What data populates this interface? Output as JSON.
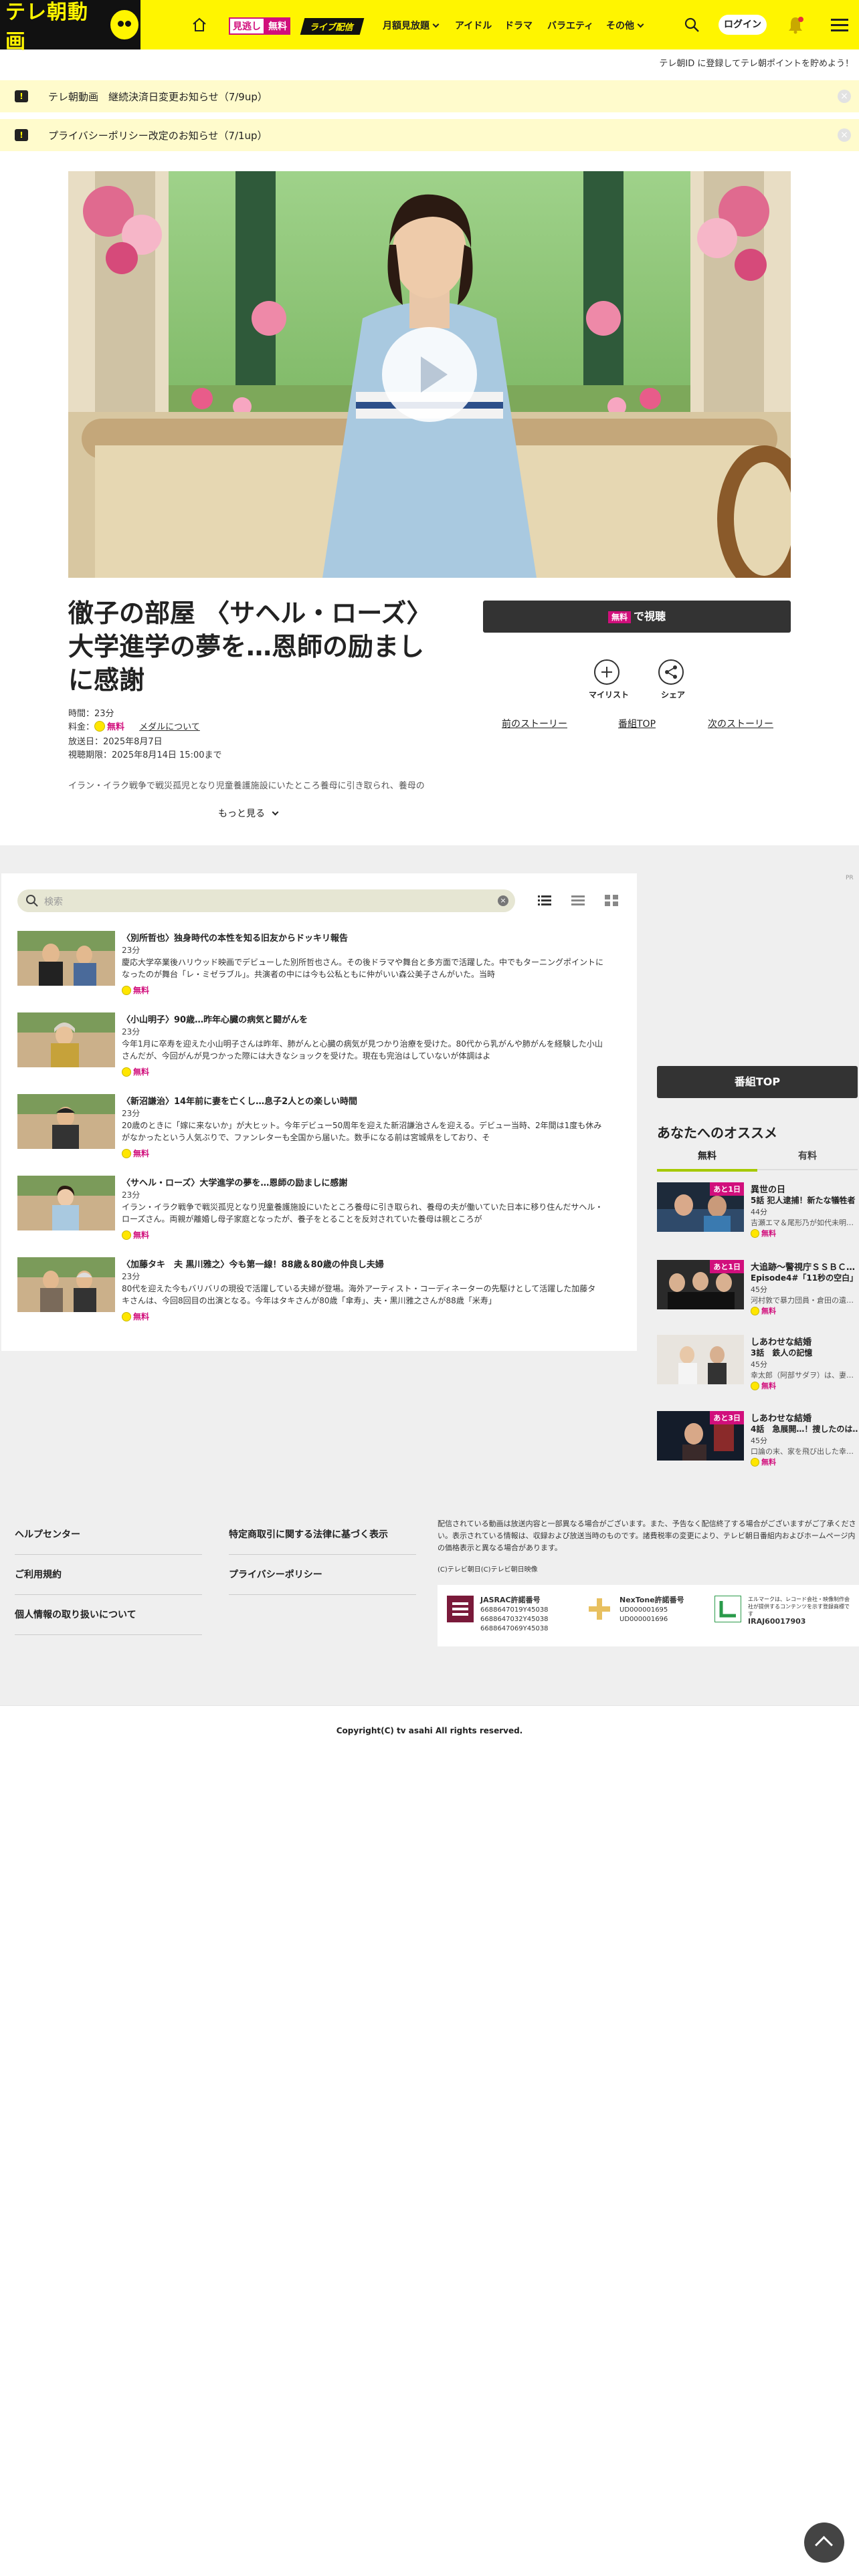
{
  "header": {
    "logo_text": "テレ朝動画",
    "badge_mitai": "見逃し",
    "badge_free": "無料",
    "badge_live": "ライブ配信",
    "nav": [
      "月額見放題",
      "アイドル",
      "ドラマ",
      "バラエティ",
      "その他"
    ],
    "login_label": "ログイン",
    "promo_text": "テレ朝ID に登録してテレ朝ポイントを貯めよう！"
  },
  "notices": [
    {
      "text": "テレ朝動画　継続決済日変更お知らせ（7/9up）"
    },
    {
      "text": "プライバシーポリシー改定のお知らせ（7/1up）"
    }
  ],
  "program": {
    "title": "徹子の部屋 〈サヘル・ローズ〉大学進学の夢を…恩師の励ましに感謝",
    "duration": "時間：23分",
    "price_label": "料金：",
    "price_free": "無料",
    "price_link": "メダルについて",
    "air_date": "放送日：2025年8月7日",
    "deadline": "視聴期限：2025年8月14日 15:00まで",
    "description": "イラン・イラク戦争で戦災孤児となり児童養護施設にいたところ養母に引き取られ、養母の",
    "more_label": "もっと見る",
    "watch_tag": "無料",
    "watch_label": "で視聴",
    "mylist_label": "マイリスト",
    "share_label": "シェア",
    "prev_label": "前のストーリー",
    "top_label": "番組TOP",
    "next_label": "次のストーリー"
  },
  "list": {
    "search_placeholder": "検索",
    "pr_label": "PR",
    "free_label": "無料",
    "episodes": [
      {
        "title": "〈別所哲也〉独身時代の本性を知る旧友からドッキリ報告",
        "duration": "23分",
        "desc": "慶応大学卒業後ハリウッド映画でデビューした別所哲也さん。その後ドラマや舞台と多方面で活躍した。中でもターニングポイントになったのが舞台「レ・ミゼラブル」。共演者の中には今も公私ともに仲がいい森公美子さんがいた。当時"
      },
      {
        "title": "〈小山明子〉90歳…昨年心臓の病気と闘がんを",
        "duration": "23分",
        "desc": "今年1月に卒寿を迎えた小山明子さんは昨年、肺がんと心臓の病気が見つかり治療を受けた。80代から乳がんや肺がんを経験した小山さんだが、今回がんが見つかった際には大きなショックを受けた。現在も完治はしていないが体調はよ"
      },
      {
        "title": "〈新沼謙治〉14年前に妻を亡くし…息子2人との楽しい時間",
        "duration": "23分",
        "desc": "20歳のときに「嫁に来ないか」が大ヒット。今年デビュー50周年を迎えた新沼謙治さんを迎える。デビュー当時、2年間は1度も休みがなかったという人気ぶりで、ファンレターも全国から届いた。数手になる前は宮城県をしており、そ"
      },
      {
        "title": "〈サヘル・ローズ〉大学進学の夢を…恩師の励ましに感謝",
        "duration": "23分",
        "desc": "イラン・イラク戦争で戦災孤児となり児童養護施設にいたところ養母に引き取られ、養母の夫が働いていた日本に移り住んだサヘル・ローズさん。両親が離婚し母子家庭となったが、養子をとることを反対されていた養母は親ところが"
      },
      {
        "title": "〈加藤タキ　夫 黒川雅之〉今も第一線！88歳＆80歳の仲良し夫婦",
        "duration": "23分",
        "desc": "80代を迎えた今もバリバリの現役で活躍している夫婦が登場。海外アーティスト・コーディネーターの先駆けとして活躍した加藤タキさんは、今回8回目の出演となる。今年はタキさんが80歳「傘寿」、夫・黒川雅之さんが88歳「米寿」"
      }
    ]
  },
  "sidebar": {
    "top_button": "番組TOP",
    "heading": "あなたへのオススメ",
    "tabs": [
      "無料",
      "有料"
    ],
    "items": [
      {
        "badge": "あと1日",
        "title": "異世の日",
        "subtitle": "5話 犯人逮捕！新たな犠牲者",
        "duration": "44分",
        "desc": "吉瀬エマ＆尾形乃が如代未明…"
      },
      {
        "badge": "あと1日",
        "title": "大追跡〜警視庁ＳＳＢＣ…",
        "subtitle": "Episode4#「11秒の空白」",
        "duration": "45分",
        "desc": "河村敦で暴力団員・倉田の遺…"
      },
      {
        "badge": "",
        "title": "しあわせな結婚",
        "subtitle": "3話　鉄人の記憶",
        "duration": "45分",
        "desc": "幸太郎（阿部サダヲ）は、妻…"
      },
      {
        "badge": "あと3日",
        "title": "しあわせな結婚",
        "subtitle": "4話　急展開…！捜したのは…",
        "duration": "45分",
        "desc": "口論の末、家を飛び出した幸…"
      }
    ]
  },
  "footer": {
    "links_left": [
      "ヘルプセンター",
      "ご利用規約",
      "個人情報の取り扱いについて"
    ],
    "links_mid": [
      "特定商取引に関する法律に基づく表示",
      "プライバシーポリシー"
    ],
    "note": "配信されている動画は放送内容と一部異なる場合がございます。また、予告なく配信終了する場合がございますがご了承ください。表示されている情報は、収録および放送当時のものです。諸費税率の変更により、テレビ朝日番組内およびホームページ内の価格表示と異なる場合があります。",
    "copyright_small": "(C)テレビ朝日(C)テレビ朝日映像",
    "jasrac_title": "JASRAC許諾番号",
    "jasrac_nums": [
      "6688647019Y45038",
      "6688647032Y45038",
      "6688647069Y45038"
    ],
    "nextone_title": "NexTone許諾番号",
    "nextone_nums": [
      "UD000001695",
      "UD000001696"
    ],
    "lmark_text": "エルマークは、レコード会社・映像制作会社が提供するコンテンツを示す登録商標です",
    "lmark_num": "IRAJ60017903",
    "copyright": "Copyright(C) tv asahi All rights reserved."
  }
}
